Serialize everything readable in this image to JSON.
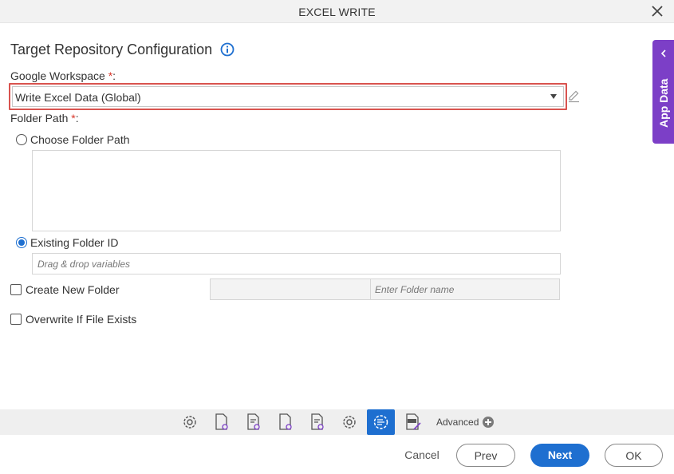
{
  "window": {
    "title": "EXCEL WRITE"
  },
  "section": {
    "title": "Target Repository Configuration"
  },
  "google_workspace": {
    "label": "Google Workspace",
    "required_mark": "*",
    "colon": ":",
    "selected": "Write Excel Data (Global)"
  },
  "folder_path": {
    "label": "Folder Path",
    "required_mark": "*",
    "colon": ":",
    "options": [
      {
        "label": "Choose Folder Path",
        "checked": false
      },
      {
        "label": "Existing Folder ID",
        "checked": true
      }
    ],
    "existing_folder_placeholder": "Drag & drop variables"
  },
  "create_new_folder": {
    "label": "Create New Folder",
    "checked": false,
    "placeholder": "Enter Folder name"
  },
  "overwrite": {
    "label": "Overwrite If File Exists",
    "checked": false
  },
  "side_panel": {
    "label": "App Data",
    "color": "#7c3fc7"
  },
  "toolbar": {
    "icons": [
      "settings-icon",
      "document-settings-icon",
      "list-settings-icon",
      "document-settings-icon",
      "list-settings-icon",
      "settings-icon",
      "active-settings-icon",
      "xls-edit-icon"
    ],
    "advanced_label": "Advanced"
  },
  "footer": {
    "cancel": "Cancel",
    "prev": "Prev",
    "next": "Next",
    "ok": "OK"
  },
  "colors": {
    "accent": "#1e6fd0",
    "required": "#d9372b",
    "highlight": "#d9534f"
  }
}
